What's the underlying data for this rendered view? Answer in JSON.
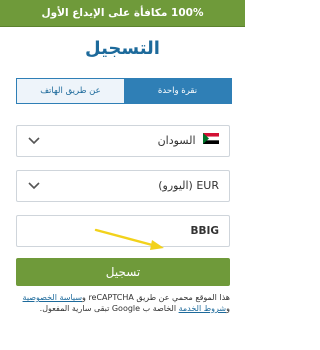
{
  "banner": {
    "text": "100% مكافأة على الإيداع الأول"
  },
  "title": "التسجيل",
  "tabs": [
    {
      "label": "عن طريق الهاتف"
    },
    {
      "label": "نقرة واحدة"
    }
  ],
  "country": {
    "value": "السودان",
    "flag_icon": "sudan-flag"
  },
  "currency": {
    "value": "EUR (اليورو)"
  },
  "promo": {
    "value": "BBIG"
  },
  "register": {
    "label": "تسجيل"
  },
  "note": {
    "p1": "هذا الموقع محمي عن طريق reCAPTCHA و",
    "privacy": "سياسة الخصوصية",
    "p2": " و",
    "terms": "شروط الخدمة",
    "p3": " الخاصة ب Google تبقى سارية المفعول."
  },
  "colors": {
    "green": "#6f9a3a",
    "blue": "#2f7fb6",
    "title_blue": "#1d6a9b",
    "arrow": "#f2d21b"
  }
}
